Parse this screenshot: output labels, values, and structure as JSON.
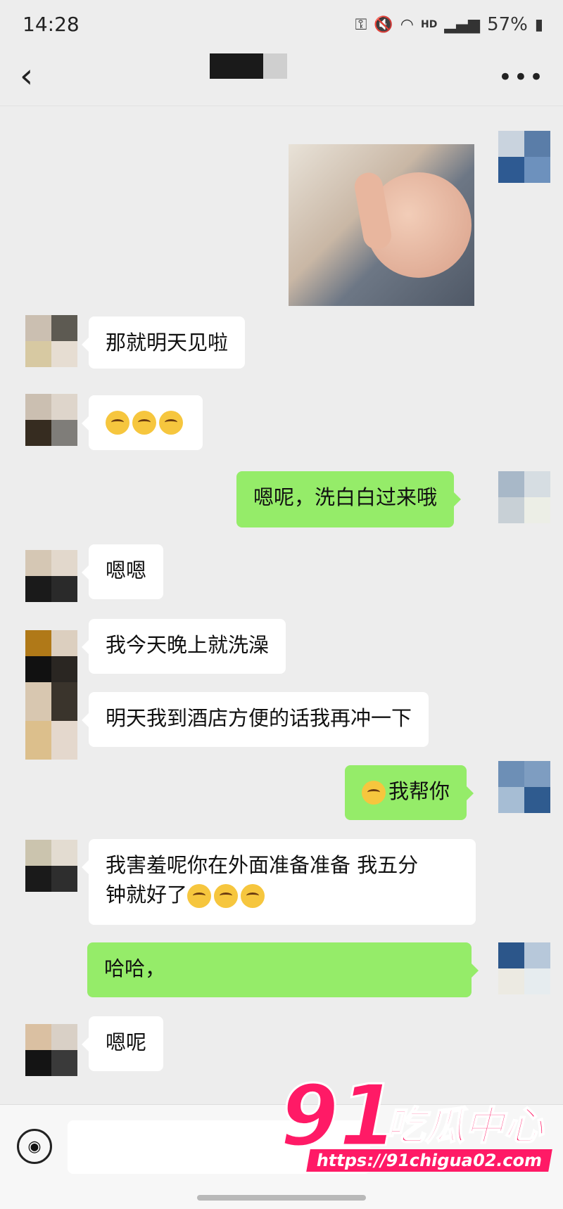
{
  "status_bar": {
    "time": "14:28",
    "battery": "57%",
    "icons": [
      "key-icon",
      "mute-icon",
      "wifi-icon",
      "hd-icon",
      "signal-icon",
      "battery-icon"
    ],
    "hd_label": "HD"
  },
  "nav": {
    "back_icon": "chevron-left-icon",
    "more_icon": "more-icon",
    "more_glyph": "•••"
  },
  "messages": [
    {
      "side": "out",
      "type": "image"
    },
    {
      "side": "in",
      "text": "那就明天见啦"
    },
    {
      "side": "in",
      "type": "emoji",
      "count": 3
    },
    {
      "side": "out",
      "text": "嗯呢，洗白白过来哦"
    },
    {
      "side": "in",
      "text": "嗯嗯"
    },
    {
      "side": "in",
      "text": "我今天晚上就洗澡"
    },
    {
      "side": "in",
      "text": "明天我到酒店方便的话我再冲一下"
    },
    {
      "side": "out",
      "text": "我帮你",
      "emoji_prefix": true
    },
    {
      "side": "in",
      "text": "我害羞呢你在外面准备准备 我五分",
      "text2": "钟就好了",
      "emoji_suffix": 3
    },
    {
      "side": "out",
      "text": "哈哈，"
    },
    {
      "side": "in",
      "text": "嗯呢"
    }
  ],
  "input_bar": {
    "voice_icon": "voice-icon"
  },
  "watermark": {
    "number": "91",
    "text": "吃瓜中心",
    "url": "https://91chigua02.com"
  },
  "colors": {
    "bubble_out": "#95ec69",
    "bubble_in": "#ffffff",
    "background": "#ededed",
    "watermark": "#ff1a66"
  }
}
